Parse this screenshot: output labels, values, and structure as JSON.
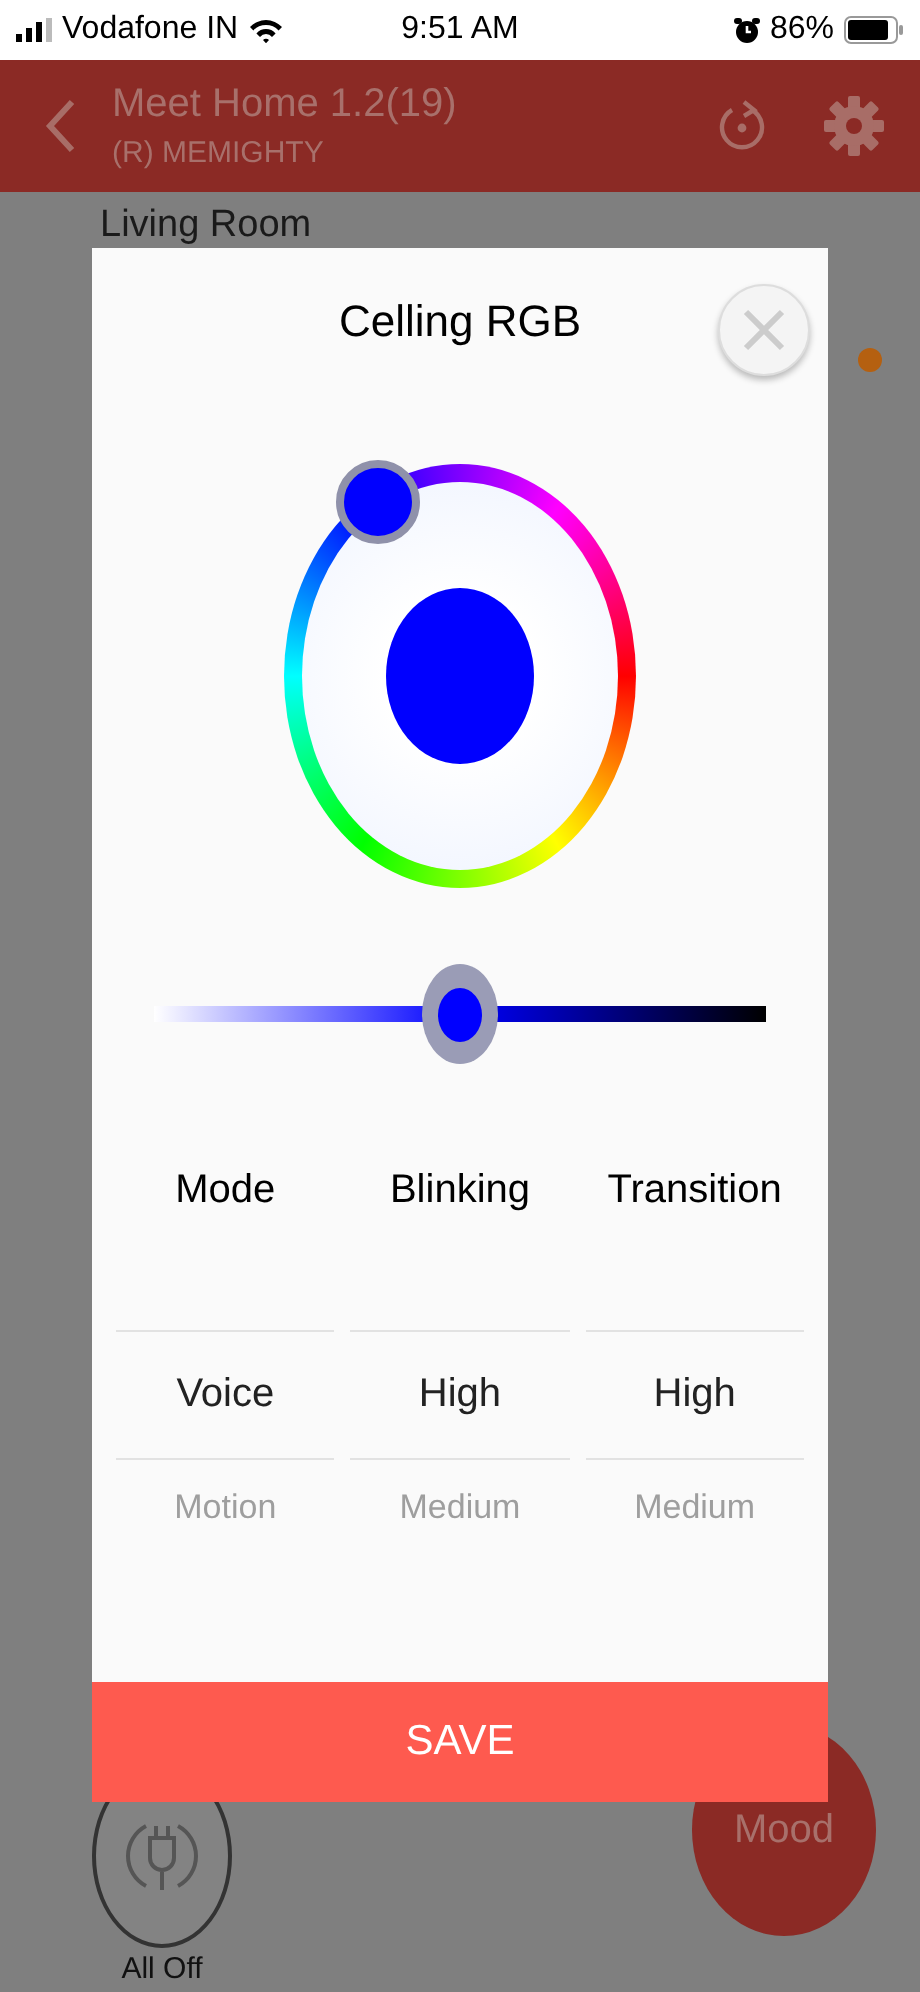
{
  "status_bar": {
    "carrier": "Vodafone IN",
    "time": "9:51 AM",
    "battery": "86%"
  },
  "header": {
    "title": "Meet Home 1.2(19)",
    "subtitle": "(R) MEMIGHTY"
  },
  "room": {
    "title": "Living Room"
  },
  "buttons": [
    {
      "label": "All Off",
      "kind": "plug"
    },
    {
      "label": "Mood",
      "kind": "mood"
    }
  ],
  "dialog": {
    "title": "Celling RGB",
    "color": "#0000ff",
    "brightness": {
      "level": 0.5
    },
    "pickers": [
      {
        "label": "Mode",
        "value": "Voice",
        "next_value": "Motion"
      },
      {
        "label": "Blinking",
        "value": "High",
        "next_value": "Medium"
      },
      {
        "label": "Transition",
        "value": "High",
        "next_value": "Medium"
      }
    ],
    "save": "SAVE"
  }
}
